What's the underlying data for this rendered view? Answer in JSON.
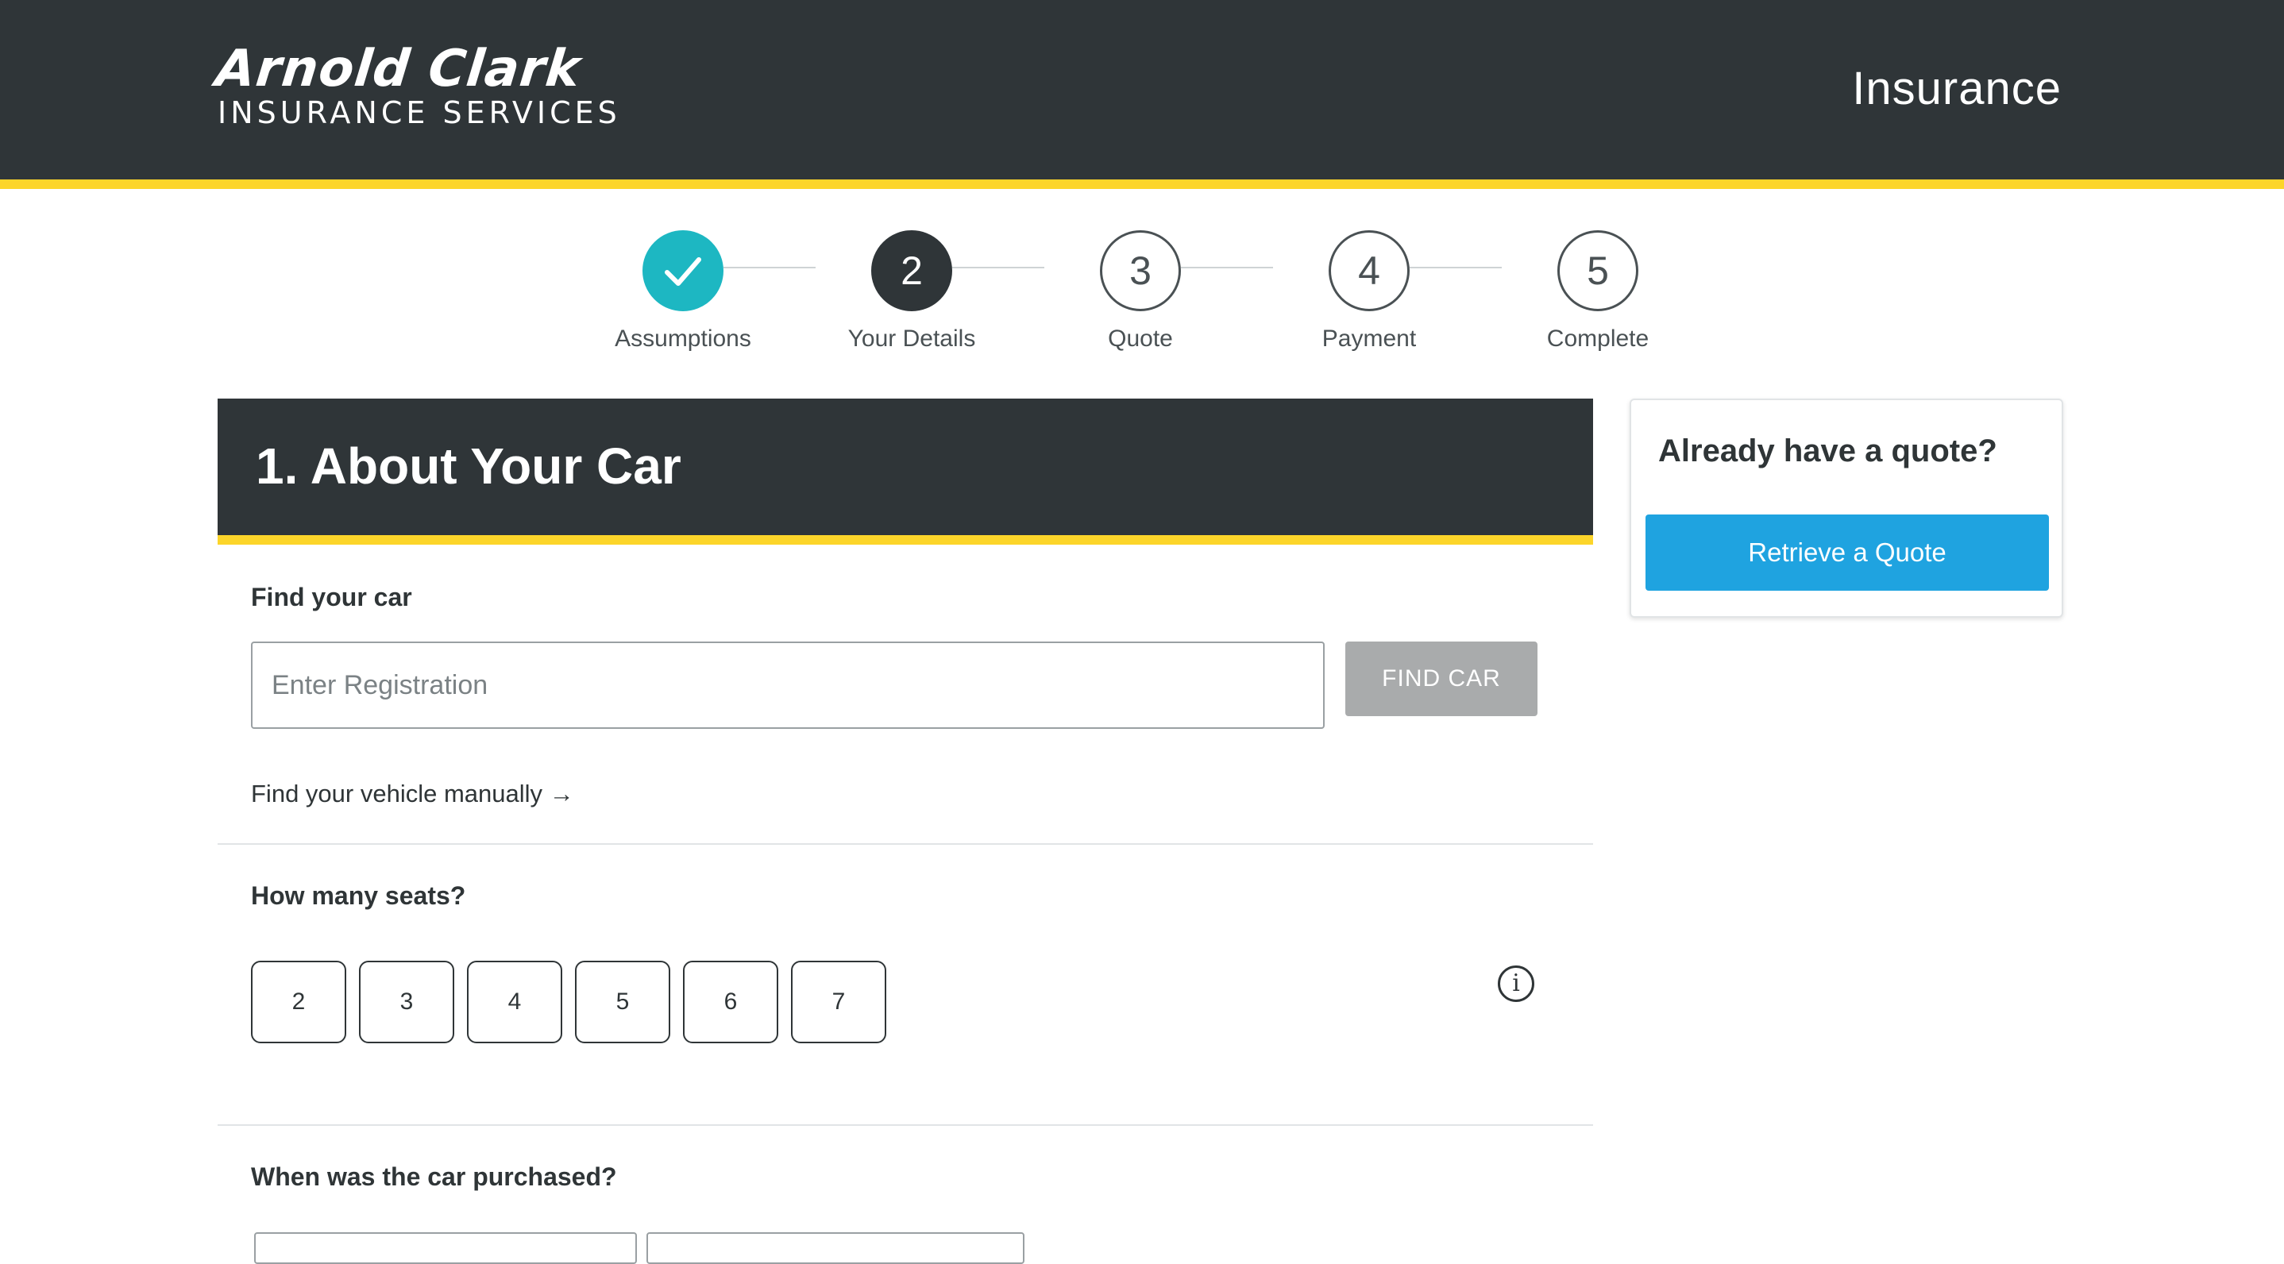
{
  "header": {
    "brand_name": "Arnold Clark",
    "brand_sub": "INSURANCE SERVICES",
    "nav_label": "Insurance"
  },
  "steps": [
    {
      "number": "",
      "label": "Assumptions",
      "state": "done"
    },
    {
      "number": "2",
      "label": "Your Details",
      "state": "active"
    },
    {
      "number": "3",
      "label": "Quote",
      "state": "pending"
    },
    {
      "number": "4",
      "label": "Payment",
      "state": "pending"
    },
    {
      "number": "5",
      "label": "Complete",
      "state": "pending"
    }
  ],
  "section": {
    "title": "1. About Your Car"
  },
  "find_car": {
    "label": "Find your car",
    "placeholder": "Enter Registration",
    "value": "",
    "button_label": "FIND CAR",
    "manual_link": "Find your vehicle manually →"
  },
  "seats": {
    "label": "How many seats?",
    "options": [
      "2",
      "3",
      "4",
      "5",
      "6",
      "7"
    ],
    "info_icon": "info-icon"
  },
  "purchase": {
    "label": "When was the car purchased?"
  },
  "side_card": {
    "title": "Already have a quote?",
    "button_label": "Retrieve a Quote"
  },
  "colors": {
    "header_bg": "#2f3538",
    "accent_yellow": "#fcd52a",
    "step_done": "#1db7c2",
    "primary_button": "#1fa3e0",
    "disabled_button": "#a9abac"
  }
}
